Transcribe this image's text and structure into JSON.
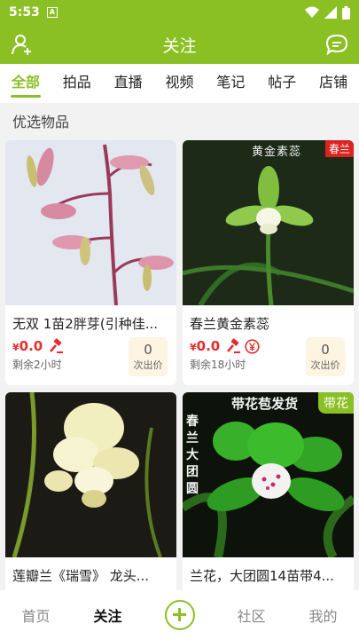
{
  "status_bar": {
    "time": "5:53",
    "notification_badge": "A"
  },
  "app_bar": {
    "title": "关注"
  },
  "tabs": [
    {
      "label": "全部",
      "active": true
    },
    {
      "label": "拍品",
      "active": false
    },
    {
      "label": "直播",
      "active": false
    },
    {
      "label": "视频",
      "active": false
    },
    {
      "label": "笔记",
      "active": false
    },
    {
      "label": "帖子",
      "active": false
    },
    {
      "label": "店铺",
      "active": false
    }
  ],
  "section_title": "优选物品",
  "items": [
    {
      "name": "无双 1苗2胖芽(引种佳...",
      "currency": "¥",
      "price": "0.0",
      "remaining": "剩余2小时",
      "bids": "0",
      "bid_label": "次出价",
      "icons": [
        "auction-hammer-icon"
      ]
    },
    {
      "name": "春兰黄金素蕊",
      "currency": "¥",
      "price": "0.0",
      "remaining": "剩余18小时",
      "bids": "0",
      "bid_label": "次出价",
      "image_text": "黄金素蕊",
      "tag": "春兰",
      "icons": [
        "auction-hammer-icon",
        "yuan-circle-icon"
      ]
    },
    {
      "name": "莲瓣兰《瑞雪》 龙头...",
      "currency": "¥",
      "price": "",
      "remaining": "",
      "bids": "",
      "bid_label": ""
    },
    {
      "name": "兰花，大团圆14苗带4...",
      "currency": "¥",
      "price": "",
      "remaining": "",
      "bids": "",
      "bid_label": "",
      "image_text": "带花苞发货",
      "image_side_text": "春兰 大团圆",
      "tag": "带花"
    }
  ],
  "bottom_nav": [
    {
      "label": "首页",
      "active": false
    },
    {
      "label": "关注",
      "active": true
    },
    {
      "label": "",
      "icon": "add-circle-icon"
    },
    {
      "label": "社区",
      "active": false
    },
    {
      "label": "我的",
      "active": false
    }
  ],
  "colors": {
    "brand": "#8bc024",
    "price": "#e52d2d",
    "bid_bg": "#fdf4e1"
  }
}
